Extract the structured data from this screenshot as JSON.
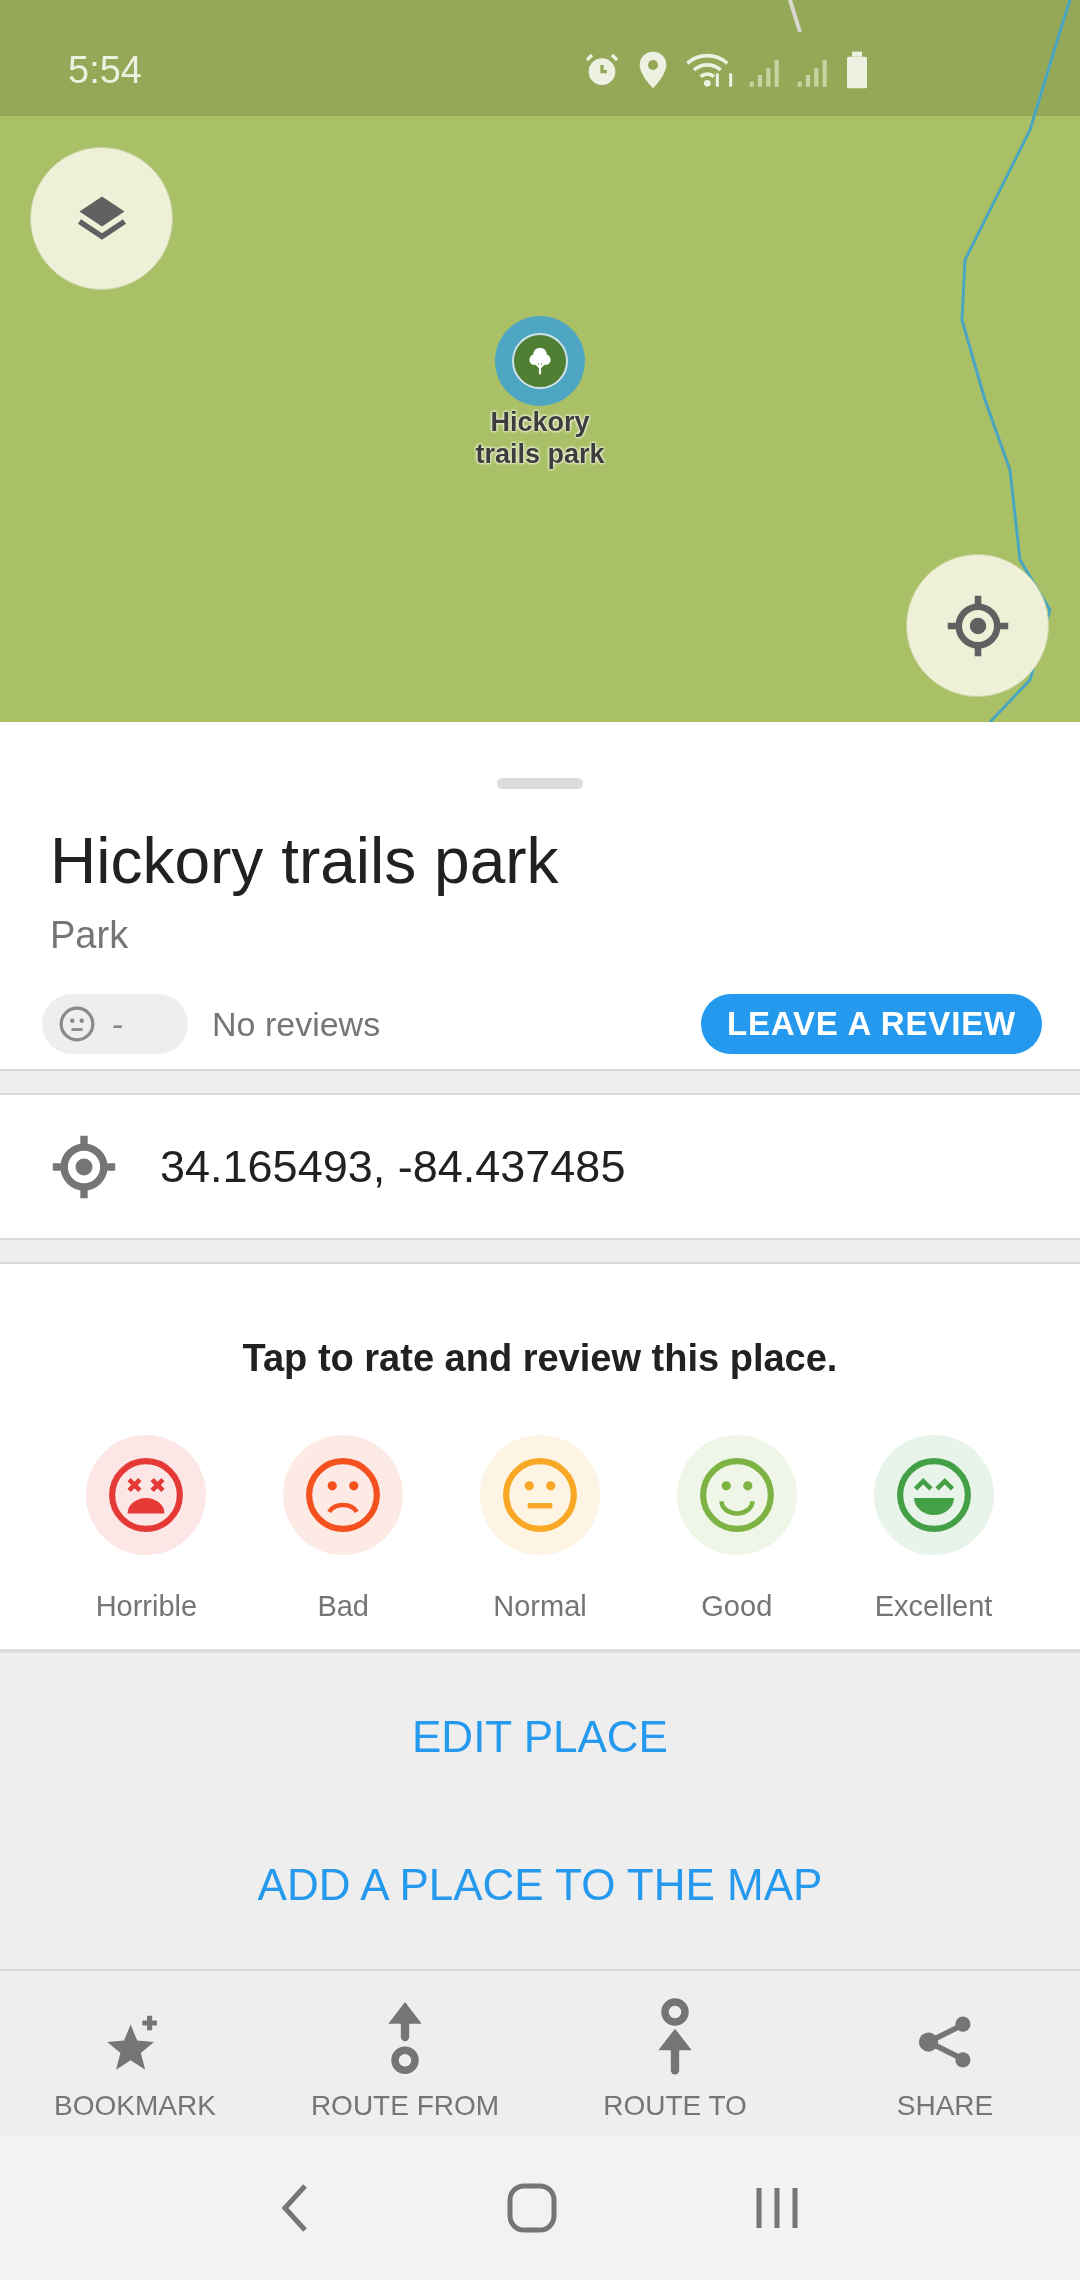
{
  "status_bar": {
    "time": "5:54"
  },
  "map": {
    "marker": {
      "label": "Hickory trails park"
    }
  },
  "place": {
    "title": "Hickory trails park",
    "category": "Park",
    "rating": {
      "score": "-",
      "text": "No reviews"
    },
    "review_button": "LEAVE A REVIEW"
  },
  "coordinates": "34.165493, -84.437485",
  "rate": {
    "prompt": "Tap to rate and review this place.",
    "options": [
      {
        "kind": "horrible",
        "label": "Horrible",
        "color": "#e53935"
      },
      {
        "kind": "bad",
        "label": "Bad",
        "color": "#f4511e"
      },
      {
        "kind": "normal",
        "label": "Normal",
        "color": "#f9a825"
      },
      {
        "kind": "good",
        "label": "Good",
        "color": "#7cb342"
      },
      {
        "kind": "excellent",
        "label": "Excellent",
        "color": "#43a047"
      }
    ]
  },
  "actions": [
    "EDIT PLACE",
    "ADD A PLACE TO THE MAP"
  ],
  "toolbar": [
    {
      "kind": "bookmark",
      "label": "BOOKMARK"
    },
    {
      "kind": "route_from",
      "label": "ROUTE FROM"
    },
    {
      "kind": "route_to",
      "label": "ROUTE TO"
    },
    {
      "kind": "share",
      "label": "SHARE"
    }
  ]
}
